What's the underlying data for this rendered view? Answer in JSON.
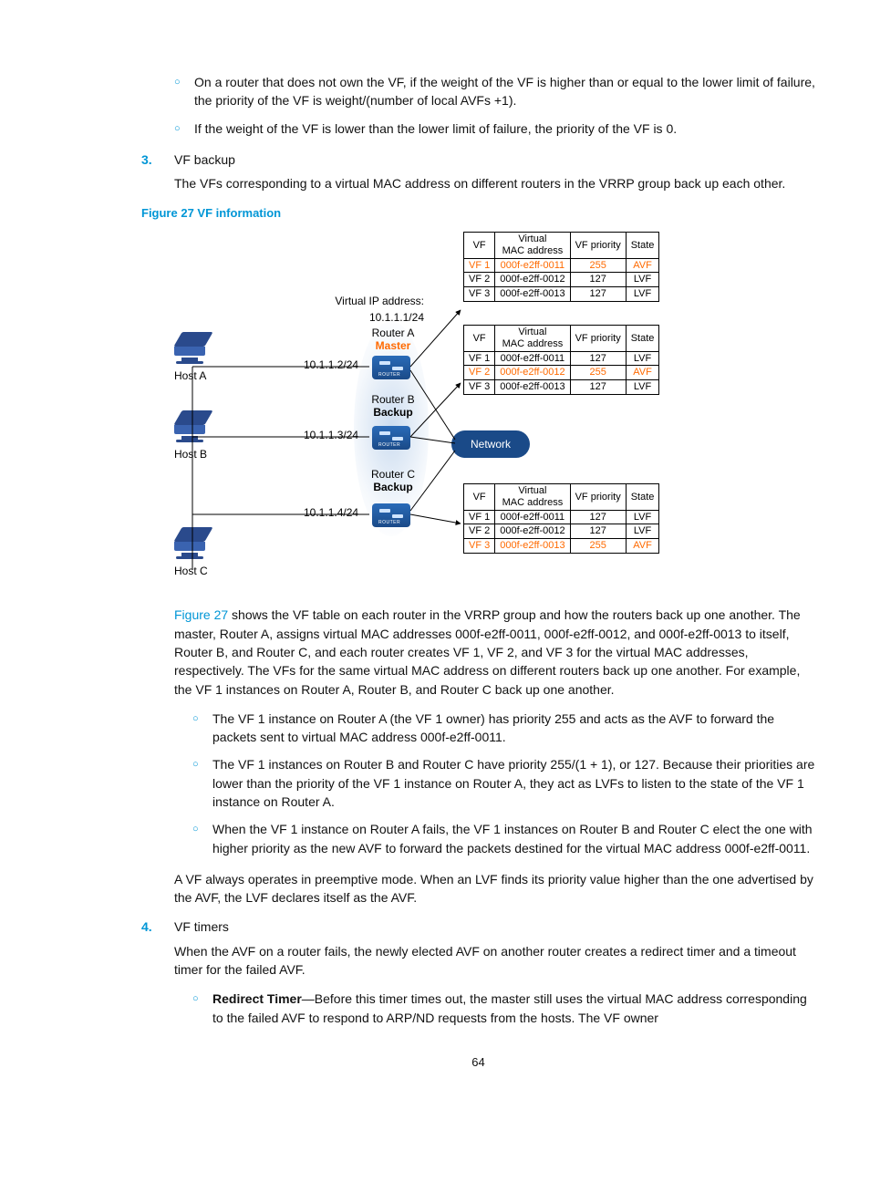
{
  "bullets_top": {
    "b1": "On a router that does not own the VF, if the weight of the VF is higher than or equal to the lower limit of failure, the priority of the VF is weight/(number of local AVFs +1).",
    "b2": "If the weight of the VF is lower than the lower limit of failure, the priority of the VF is 0."
  },
  "step3": {
    "num": "3.",
    "title": "VF backup",
    "body": "The VFs corresponding to a virtual MAC address on different routers in the VRRP group back up each other."
  },
  "figure": {
    "caption": "Figure 27 VF information",
    "ref": "Figure 27",
    "vip_label": "Virtual IP address:",
    "vip_value": "10.1.1.1/24",
    "hosts": {
      "a": "Host A",
      "b": "Host B",
      "c": "Host C"
    },
    "routers": {
      "a": "Router A",
      "a_role": "Master",
      "a_ip": "10.1.1.2/24",
      "b": "Router B",
      "b_role": "Backup",
      "b_ip": "10.1.1.3/24",
      "c": "Router C",
      "c_role": "Backup",
      "c_ip": "10.1.1.4/24"
    },
    "network": "Network",
    "headers": {
      "vf": "VF",
      "mac": "Virtual\nMAC address",
      "prio": "VF priority",
      "state": "State"
    },
    "tableA": [
      {
        "vf": "VF 1",
        "mac": "000f-e2ff-0011",
        "prio": "255",
        "state": "AVF",
        "hl": true
      },
      {
        "vf": "VF 2",
        "mac": "000f-e2ff-0012",
        "prio": "127",
        "state": "LVF"
      },
      {
        "vf": "VF 3",
        "mac": "000f-e2ff-0013",
        "prio": "127",
        "state": "LVF"
      }
    ],
    "tableB": [
      {
        "vf": "VF 1",
        "mac": "000f-e2ff-0011",
        "prio": "127",
        "state": "LVF"
      },
      {
        "vf": "VF 2",
        "mac": "000f-e2ff-0012",
        "prio": "255",
        "state": "AVF",
        "hl": true
      },
      {
        "vf": "VF 3",
        "mac": "000f-e2ff-0013",
        "prio": "127",
        "state": "LVF"
      }
    ],
    "tableC": [
      {
        "vf": "VF 1",
        "mac": "000f-e2ff-0011",
        "prio": "127",
        "state": "LVF"
      },
      {
        "vf": "VF 2",
        "mac": "000f-e2ff-0012",
        "prio": "127",
        "state": "LVF"
      },
      {
        "vf": "VF 3",
        "mac": "000f-e2ff-0013",
        "prio": "255",
        "state": "AVF",
        "hl": true
      }
    ]
  },
  "para_after_fig": " shows the VF table on each router in the VRRP group and how the routers back up one another. The master, Router A, assigns virtual MAC addresses 000f-e2ff-0011, 000f-e2ff-0012, and 000f-e2ff-0013 to itself, Router B, and Router C, and each router creates VF 1, VF 2, and VF 3 for the virtual MAC addresses, respectively. The VFs for the same virtual MAC address on different routers back up one another. For example, the VF 1 instances on Router A, Router B, and Router C back up one another.",
  "bullets_mid": {
    "b1": "The VF 1 instance on Router A (the VF 1 owner) has priority 255 and acts as the AVF to forward the packets sent to virtual MAC address 000f-e2ff-0011.",
    "b2": "The VF 1 instances on Router B and Router C have priority 255/(1 + 1), or 127. Because their priorities are lower than the priority of the VF 1 instance on Router A, they act as LVFs to listen to the state of the VF 1 instance on Router A.",
    "b3": "When the VF 1 instance on Router A fails, the VF 1 instances on Router B and Router C elect the one with higher priority as the new AVF to forward the packets destined for the virtual MAC address 000f-e2ff-0011."
  },
  "preempt_para": "A VF always operates in preemptive mode. When an LVF finds its priority value higher than the one advertised by the AVF, the LVF declares itself as the AVF.",
  "step4": {
    "num": "4.",
    "title": "VF timers",
    "body": "When the AVF on a router fails, the newly elected AVF on another router creates a redirect timer and a timeout timer for the failed AVF."
  },
  "redirect": {
    "label": "Redirect Timer",
    "text": "—Before this timer times out, the master still uses the virtual MAC address corresponding to the failed AVF to respond to ARP/ND requests from the hosts. The VF owner"
  },
  "page": "64"
}
